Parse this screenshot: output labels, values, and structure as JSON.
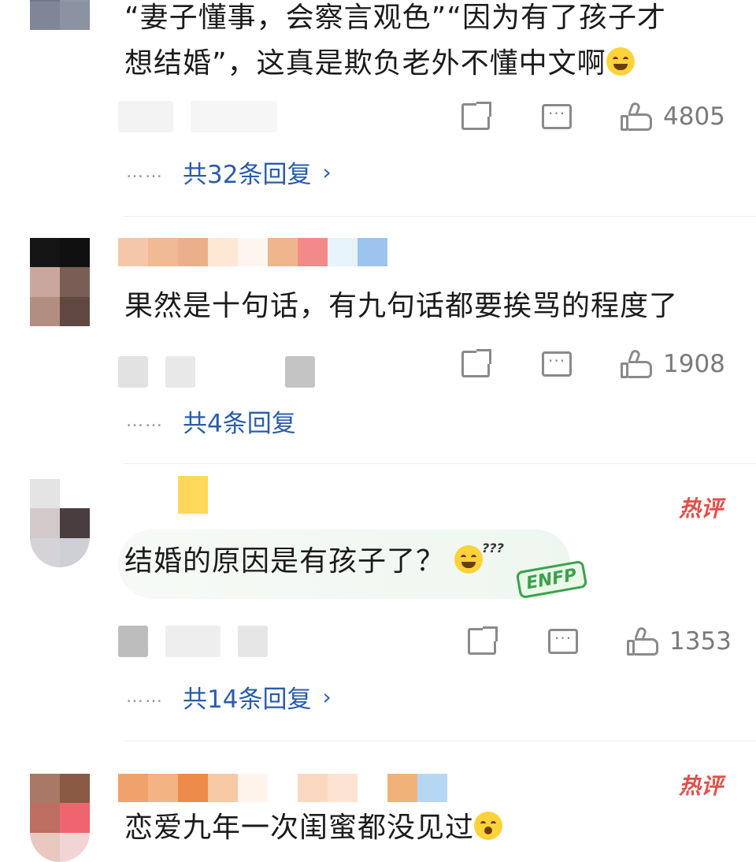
{
  "colors": {
    "text": "#1b1b1b",
    "meta": "#7a7a7a",
    "link": "#2a5caa",
    "hot": "#e0504a",
    "divider": "#ececec"
  },
  "comments": [
    {
      "text_line1": "“妻子懂事，会察言观色”“因为有了孩子才",
      "text_line2": "想结婚”，这真是欺负老外不懂中文啊",
      "emoji": "laughing-emoji",
      "likes": "4805",
      "replies": "共32条回复"
    },
    {
      "text_line1": "果然是十句话，有九句话都要挨骂的程度了",
      "likes": "1908",
      "replies": "共4条回复"
    },
    {
      "hot_label": "热评",
      "text_line1": "结婚的原因是有孩子了？",
      "emoji": "grinning-emoji",
      "sticker": "ENFP",
      "likes": "1353",
      "replies": "共14条回复"
    },
    {
      "hot_label": "热评",
      "text_line1": "恋爱九年一次闺蜜都没见过",
      "emoji": "confused-emoji"
    }
  ],
  "icons": {
    "share": "share-icon",
    "comment": "comment-icon",
    "like": "thumbs-up-icon",
    "chevron": "chevron-right-icon"
  },
  "glyphs": {
    "dots": "……",
    "chevron": "›"
  }
}
